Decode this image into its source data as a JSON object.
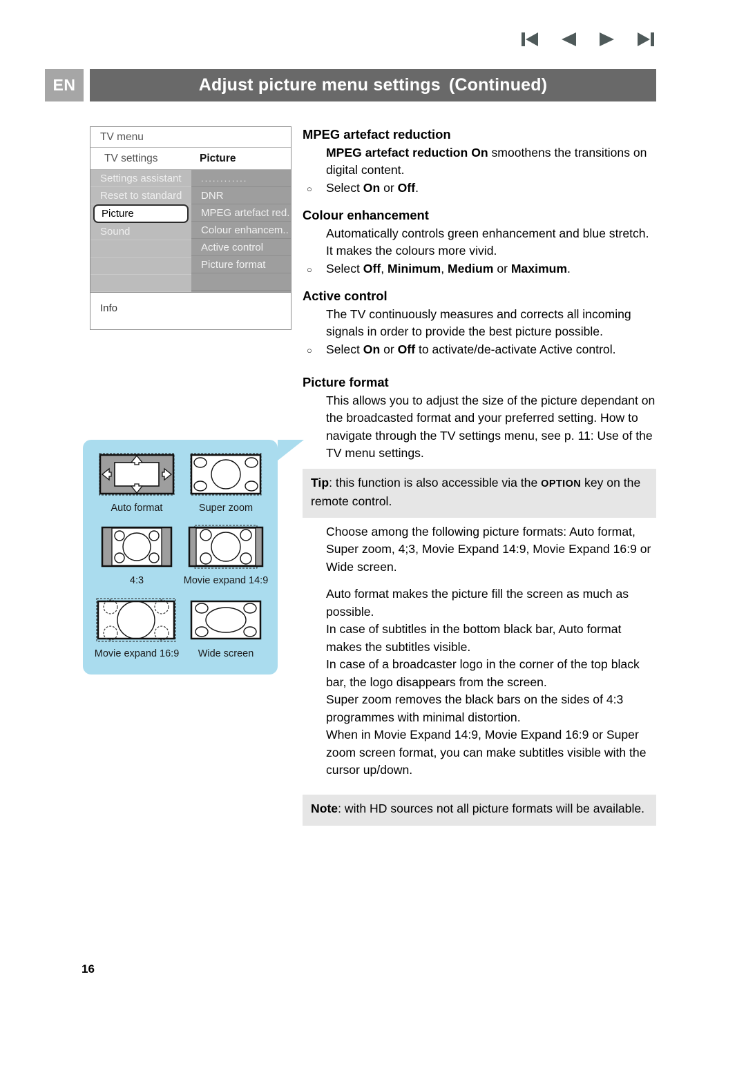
{
  "nav": {
    "first_label": "first-page",
    "prev_label": "previous-page",
    "next_label": "next-page",
    "last_label": "last-page"
  },
  "header": {
    "language_badge": "EN",
    "title": "Adjust picture menu settings",
    "title_continued": "(Continued)"
  },
  "tv_menu": {
    "title": "TV menu",
    "sub_left": "TV settings",
    "sub_right": "Picture",
    "left_items": [
      {
        "label": "Settings assistant",
        "selected": false
      },
      {
        "label": "Reset to standard",
        "selected": false
      },
      {
        "label": "Picture",
        "selected": true
      },
      {
        "label": "Sound",
        "selected": false
      },
      {
        "label": "",
        "selected": false
      },
      {
        "label": "",
        "selected": false
      },
      {
        "label": "",
        "selected": false
      }
    ],
    "right_items": [
      {
        "label": "............",
        "dots": true
      },
      {
        "label": "DNR",
        "dots": false
      },
      {
        "label": "MPEG artefact red.",
        "dots": false
      },
      {
        "label": "Colour enhancem..",
        "dots": false
      },
      {
        "label": "Active control",
        "dots": false
      },
      {
        "label": "Picture format",
        "dots": false
      },
      {
        "label": "",
        "dots": false
      }
    ],
    "info_label": "Info"
  },
  "picture_formats": [
    {
      "id": "auto-format",
      "label": "Auto format"
    },
    {
      "id": "super-zoom",
      "label": "Super zoom"
    },
    {
      "id": "four-three",
      "label": "4:3"
    },
    {
      "id": "movie-expand-149",
      "label": "Movie expand 14:9"
    },
    {
      "id": "movie-expand-169",
      "label": "Movie expand 16:9"
    },
    {
      "id": "wide-screen",
      "label": "Wide screen"
    }
  ],
  "sections": {
    "mpeg": {
      "heading": "MPEG artefact reduction",
      "body_bold": "MPEG artefact reduction On",
      "body_rest": " smoothens the transitions on digital content.",
      "bullet_pre": "Select ",
      "bullet_b1": "On",
      "bullet_mid": " or ",
      "bullet_b2": "Off",
      "bullet_post": "."
    },
    "colour": {
      "heading": "Colour enhancement",
      "body": "Automatically controls green enhancement and blue stretch. It makes the colours more vivid.",
      "bullet_pre": "Select ",
      "bullet_b1": "Off",
      "bullet_s1": ", ",
      "bullet_b2": "Minimum",
      "bullet_s2": ", ",
      "bullet_b3": "Medium",
      "bullet_s3": " or ",
      "bullet_b4": "Maximum",
      "bullet_post": "."
    },
    "active": {
      "heading": "Active control",
      "body": "The TV continuously measures and corrects all incoming signals in order to provide the best picture possible.",
      "bullet_pre": "Select ",
      "bullet_b1": "On",
      "bullet_mid": " or ",
      "bullet_b2": "Off",
      "bullet_post": " to activate/de-activate Active control."
    },
    "format": {
      "heading": "Picture format",
      "body": "This allows you to adjust the size of the picture dependant on the broadcasted format and your preferred setting. How to navigate through the TV settings menu, see p. 11: Use of the TV menu settings.",
      "tip_label": "Tip",
      "tip_pre": ": this function is also accessible via the ",
      "tip_key": "OPTION",
      "tip_post": " key on the remote control.",
      "choose": "Choose among the following picture formats: Auto format, Super zoom, 4;3, Movie Expand 14:9, Movie Expand 16:9 or Wide screen.",
      "auto": "Auto format makes the picture fill the screen as much as possible.",
      "subtitles": "In case of subtitles in the bottom black bar, Auto format makes the subtitles visible.",
      "logo": "In case of a broadcaster logo in the corner of the top black bar, the logo disappears from the screen.",
      "superzoom": "Super zoom removes the black bars on the sides of 4:3 programmes with minimal distortion.",
      "movieexpand": "When in Movie Expand 14:9, Movie Expand 16:9 or Super zoom screen format, you can make subtitles visible with the cursor up/down.",
      "note_label": "Note",
      "note_body": ": with HD sources not all picture formats will be available."
    }
  },
  "page_number": "16",
  "colors": {
    "header_bar": "#696969",
    "badge": "#a6a6a6",
    "panel_blue": "#aadcee",
    "tip_bg": "#e6e6e6",
    "menu_left": "#bcbcbc",
    "menu_right": "#9e9e9e",
    "nav_icon": "#4f5a5a"
  }
}
